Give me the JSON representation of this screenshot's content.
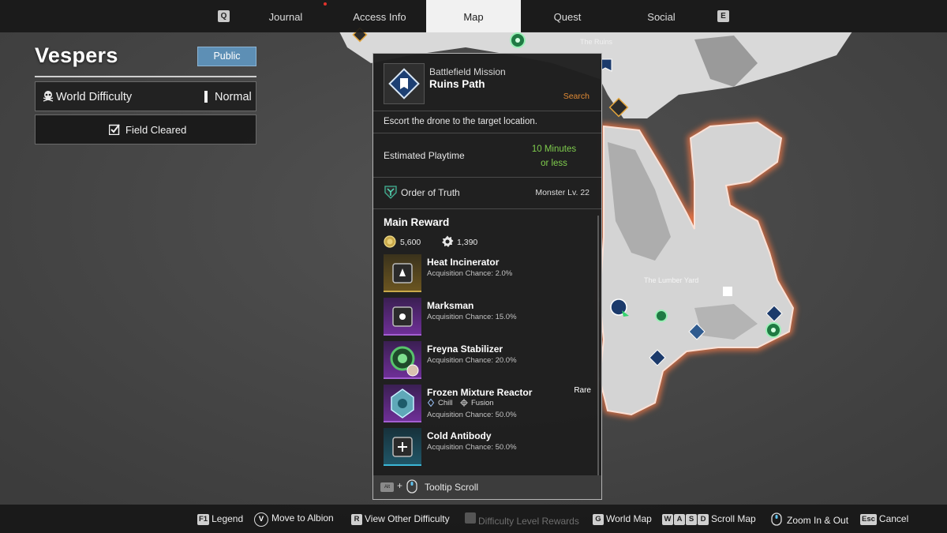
{
  "nav": {
    "left_key": "Q",
    "right_key": "E",
    "tabs": [
      {
        "label": "Journal",
        "active": false
      },
      {
        "label": "Access Info",
        "active": false
      },
      {
        "label": "Map",
        "active": true
      },
      {
        "label": "Quest",
        "active": false
      },
      {
        "label": "Social",
        "active": false
      }
    ]
  },
  "region": {
    "title": "Vespers",
    "visibility_button": "Public",
    "difficulty_label": "World Difficulty",
    "difficulty_value": "Normal",
    "field_status": "Field Cleared"
  },
  "map": {
    "labels": [
      "The Ruins",
      "The Lumber Yard"
    ]
  },
  "mission": {
    "type": "Battlefield Mission",
    "name": "Ruins Path",
    "status": "Search",
    "description": "Escort the drone to the target location.",
    "playtime_label": "Estimated Playtime",
    "playtime_value_line1": "10 Minutes",
    "playtime_value_line2": "or less",
    "faction": "Order of Truth",
    "monster_level": "Monster Lv. 22",
    "reward_title": "Main Reward",
    "gold": "5,600",
    "xp": "1,390",
    "rewards": [
      {
        "name": "Heat Incinerator",
        "chance": "Acquisition Chance: 2.0%",
        "tier_color": "#b08a2a"
      },
      {
        "name": "Marksman",
        "chance": "Acquisition Chance: 15.0%",
        "tier_color": "#7a3aa6"
      },
      {
        "name": "Freyna Stabilizer",
        "chance": "Acquisition Chance: 20.0%",
        "tier_color": "#7a3aa6"
      },
      {
        "name": "Frozen Mixture Reactor",
        "chance": "Acquisition Chance: 50.0%",
        "rarity": "Rare",
        "tags": [
          "Chill",
          "Fusion"
        ],
        "tier_color": "#7a3aa6"
      },
      {
        "name": "Cold Antibody",
        "chance": "Acquisition Chance: 50.0%",
        "tier_color": "#2d8ea8"
      }
    ],
    "footer_key": "Alt",
    "footer_plus": "+",
    "footer_text": "Tooltip Scroll"
  },
  "bottom_hints": [
    {
      "key": "F1",
      "label": "Legend",
      "enabled": true
    },
    {
      "key": "V",
      "label": "Move to Albion",
      "enabled": true
    },
    {
      "key": "R",
      "label": "View Other Difficulty",
      "enabled": true
    },
    {
      "key": "",
      "label": "Difficulty Level Rewards",
      "enabled": false
    },
    {
      "key": "G",
      "label": "World Map",
      "enabled": true
    },
    {
      "keys": [
        "W",
        "A",
        "S",
        "D"
      ],
      "label": "Scroll Map",
      "enabled": true
    },
    {
      "key": "mouse-wheel",
      "label": "Zoom In & Out",
      "enabled": true
    },
    {
      "key": "Esc",
      "label": "Cancel",
      "enabled": true
    }
  ]
}
